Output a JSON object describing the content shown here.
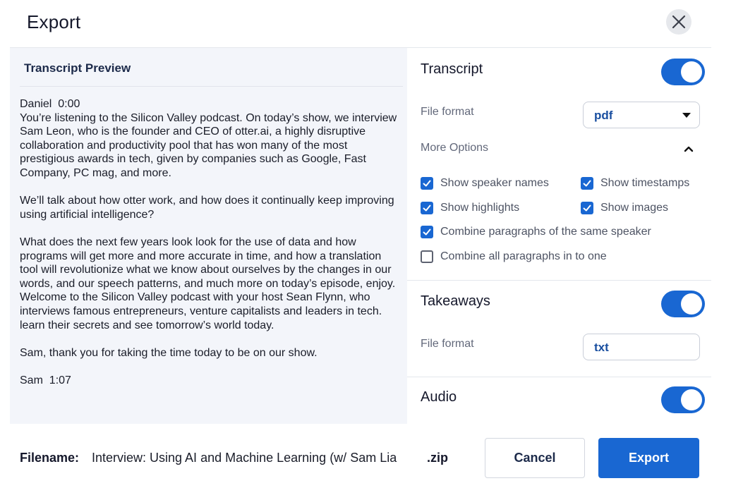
{
  "dialog": {
    "title": "Export",
    "close_icon": "close-icon"
  },
  "preview": {
    "header": "Transcript Preview",
    "blocks": [
      {
        "speaker": "Daniel",
        "time": "0:00"
      },
      {
        "text": "You’re listening to the Silicon Valley podcast. On today’s show, we interview Sam Leon, who is the founder and CEO of otter.ai, a highly disruptive collaboration and productivity pool that has won many of the most prestigious awards in tech, given by companies such as Google, Fast Company, PC mag, and more."
      },
      {
        "text": "We’ll talk about how otter work, and how does it continually keep improving using artificial intelligence?"
      },
      {
        "text": "What does the next few years look look for the use of data and how programs will get more and more accurate in time, and how a translation tool will revolutionize what we know about ourselves by the changes in our words, and our speech patterns, and much more on today’s episode, enjoy. Welcome to the Silicon Valley podcast with your host Sean Flynn, who interviews famous entrepreneurs, venture capitalists and leaders in tech. learn their secrets and see tomorrow’s world today."
      },
      {
        "text": "Sam, thank you for taking the time today to be on our show."
      },
      {
        "speaker": "Sam",
        "time": "1:07"
      }
    ]
  },
  "transcript": {
    "title": "Transcript",
    "enabled": true,
    "file_format_label": "File format",
    "file_format_value": "pdf",
    "more_options_label": "More Options",
    "more_options_icon": "chevron-up-icon",
    "options": [
      {
        "label": "Show speaker names",
        "checked": true
      },
      {
        "label": "Show timestamps",
        "checked": true
      },
      {
        "label": "Show highlights",
        "checked": true
      },
      {
        "label": "Show images",
        "checked": true
      },
      {
        "label": "Combine paragraphs of the same speaker",
        "checked": true
      },
      {
        "label": "Combine all paragraphs in to one",
        "checked": false
      }
    ]
  },
  "takeaways": {
    "title": "Takeaways",
    "enabled": true,
    "file_format_label": "File format",
    "file_format_value": "txt"
  },
  "audio": {
    "title": "Audio",
    "enabled": true
  },
  "footer": {
    "filename_label": "Filename:",
    "filename_value": "Interview: Using AI and Machine Learning (w/ Sam Lia",
    "filename_ext": ".zip",
    "cancel_label": "Cancel",
    "export_label": "Export"
  },
  "colors": {
    "accent": "#1967d2",
    "preview_bg": "#f3f5fa",
    "format_text": "#1a4fa0"
  }
}
